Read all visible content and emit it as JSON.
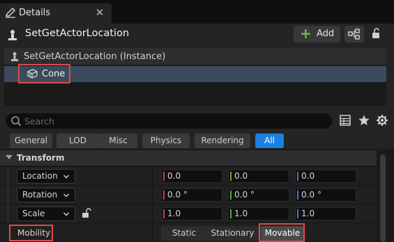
{
  "tab": {
    "label": "Details",
    "close_glyph": "✕",
    "icon": "pencil-icon"
  },
  "header": {
    "actor_name": "SetGetActorLocation",
    "add_label": "Add",
    "add_glyph": "+"
  },
  "tree": {
    "instance_label": "SetGetActorLocation (Instance)",
    "component_label": "Cone"
  },
  "search": {
    "placeholder": "Search"
  },
  "filters": [
    "General",
    "LOD",
    "Misc",
    "Physics",
    "Rendering",
    "All"
  ],
  "active_filter": "All",
  "transform": {
    "title": "Transform",
    "location": {
      "label": "Location",
      "x": "0.0",
      "y": "0.0",
      "z": "0.0"
    },
    "rotation": {
      "label": "Rotation",
      "x": "0.0 °",
      "y": "0.0 °",
      "z": "0.0 °"
    },
    "scale": {
      "label": "Scale",
      "x": "1.0",
      "y": "1.0",
      "z": "1.0"
    },
    "mobility": {
      "label": "Mobility",
      "options": [
        "Static",
        "Stationary",
        "Movable"
      ],
      "selected": "Movable"
    }
  },
  "colors": {
    "accent": "#1a7fe0",
    "highlight": "#e04a4a",
    "axis_x": "#d23b3b",
    "axis_y": "#5fa83a",
    "axis_z": "#2f7fd8",
    "add_plus": "#6fbf3e"
  }
}
